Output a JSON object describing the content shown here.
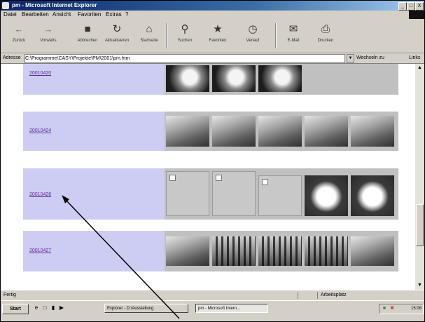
{
  "window": {
    "title": "pm - Microsoft Internet Explorer",
    "min": "_",
    "max": "□",
    "close": "X"
  },
  "menu": [
    "Datei",
    "Bearbeiten",
    "Ansicht",
    "Favoriten",
    "Extras",
    "?"
  ],
  "toolbar": {
    "back": "Zurück",
    "forward": "Vorwärts",
    "stop": "Abbrechen",
    "refresh": "Aktualisieren",
    "home": "Startseite",
    "search": "Suchen",
    "favorites": "Favoriten",
    "history": "Verlauf",
    "mail": "E-Mail",
    "print": "Drucken"
  },
  "address": {
    "label": "Adresse",
    "value": "C:\\Programme\\CASY\\Projekte\\PM\\2001\\pm.htm",
    "go": "Wechseln zu",
    "links": "Links"
  },
  "rows": [
    {
      "date": "20010420"
    },
    {
      "date": "20010424"
    },
    {
      "date": "20010426"
    },
    {
      "date": "20010427"
    }
  ],
  "status": {
    "text": "Fertig",
    "zone": "Arbeitsplatz"
  },
  "taskbar": {
    "start": "Start",
    "tasks": [
      "Explorer - D:\\Ausstellung",
      "pm - Microsoft Intern..."
    ],
    "clock": "15:08"
  }
}
